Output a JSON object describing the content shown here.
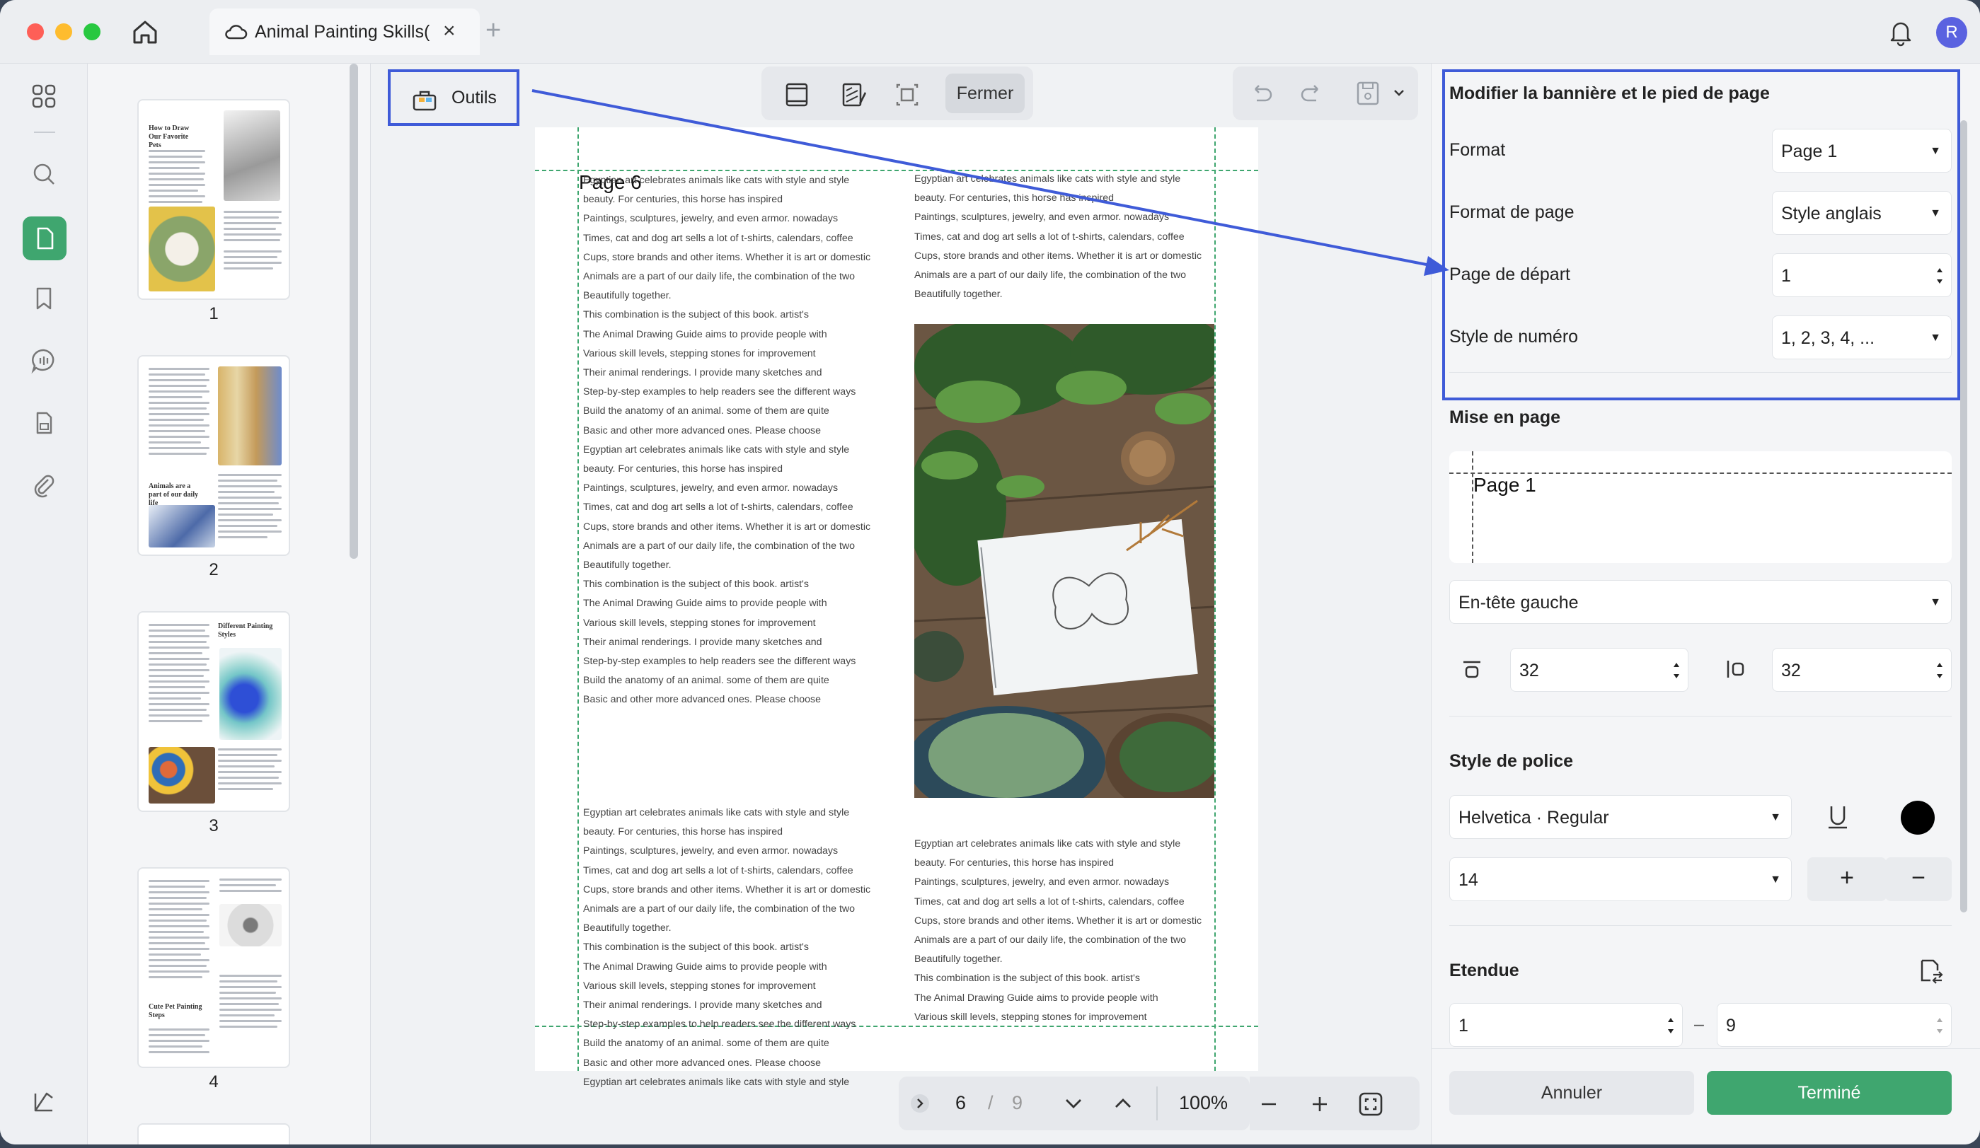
{
  "window": {
    "tab_title": "Animal Painting Skills(",
    "tab_close": "×",
    "tab_add": "+",
    "avatar_letter": "R"
  },
  "thumbnails": {
    "pages": [
      {
        "num": "1",
        "heading": "How to Draw Our Favorite Pets"
      },
      {
        "num": "2",
        "heading": "Animals are a part of our daily life"
      },
      {
        "num": "3",
        "heading": "Different Painting Styles"
      },
      {
        "num": "4",
        "heading": "Cute Pet Painting Steps"
      }
    ]
  },
  "toolbar": {
    "outils_label": "Outils",
    "fermer_label": "Fermer"
  },
  "document": {
    "page_label": "Page 6",
    "left_col_lines": [
      "Egyptian art celebrates animals like cats with style and style",
      "beauty. For centuries, this horse has inspired",
      "Paintings, sculptures, jewelry, and even armor. nowadays",
      "Times, cat and dog art sells a lot of t-shirts, calendars, coffee",
      "Cups, store brands and other items. Whether it is art or domestic",
      "Animals are a part of our daily life, the combination of the two",
      "Beautifully together.",
      "This combination is the subject of this book. artist's",
      "The Animal Drawing Guide aims to provide people with",
      "Various skill levels, stepping stones for improvement",
      "Their animal renderings. I provide many sketches and",
      "Step-by-step examples to help readers see the different ways",
      "Build the anatomy of an animal. some of them are quite",
      "Basic and other more advanced ones. Please choose",
      "Egyptian art celebrates animals like cats with style and style",
      "beauty. For centuries, this horse has inspired",
      "Paintings, sculptures, jewelry, and even armor. nowadays",
      "Times, cat and dog art sells a lot of t-shirts, calendars, coffee",
      "Cups, store brands and other items. Whether it is art or domestic",
      "Animals are a part of our daily life, the combination of the two",
      "Beautifully together.",
      "This combination is the subject of this book. artist's",
      "The Animal Drawing Guide aims to provide people with",
      "Various skill levels, stepping stones for improvement",
      "Their animal renderings. I provide many sketches and",
      "Step-by-step examples to help readers see the different ways",
      "Build the anatomy of an animal. some of them are quite",
      "Basic and other more advanced ones. Please choose"
    ],
    "left_col2_lines": [
      "Egyptian art celebrates animals like cats with style and style",
      "beauty. For centuries, this horse has inspired",
      "Paintings, sculptures, jewelry, and even armor. nowadays",
      "Times, cat and dog art sells a lot of t-shirts, calendars, coffee",
      "Cups, store brands and other items. Whether it is art or domestic",
      "Animals are a part of our daily life, the combination of the two",
      "Beautifully together.",
      "This combination is the subject of this book. artist's",
      "The Animal Drawing Guide aims to provide people with",
      "Various skill levels, stepping stones for improvement",
      "Their animal renderings. I provide many sketches and",
      "Step-by-step examples to help readers see the different ways",
      "Build the anatomy of an animal. some of them are quite",
      "Basic and other more advanced ones. Please choose",
      "Egyptian art celebrates animals like cats with style and style"
    ],
    "right_col_lines": [
      "Egyptian art celebrates animals like cats with style and style",
      "beauty. For centuries, this horse has inspired",
      "Paintings, sculptures, jewelry, and even armor. nowadays",
      "Times, cat and dog art sells a lot of t-shirts, calendars, coffee",
      "Cups, store brands and other items. Whether it is art or domestic",
      "Animals are a part of our daily life, the combination of the two",
      "Beautifully together."
    ],
    "right_col2_lines": [
      "Egyptian art celebrates animals like cats with style and style",
      "beauty. For centuries, this horse has inspired",
      "Paintings, sculptures, jewelry, and even armor. nowadays",
      "Times, cat and dog art sells a lot of t-shirts, calendars, coffee",
      "Cups, store brands and other items. Whether it is art or domestic",
      "Animals are a part of our daily life, the combination of the two",
      "Beautifully together.",
      "This combination is the subject of this book. artist's",
      "The Animal Drawing Guide aims to provide people with",
      "Various skill levels, stepping stones for improvement"
    ]
  },
  "pager": {
    "current": "6",
    "separator": "/",
    "total": "9",
    "zoom": "100%"
  },
  "panel": {
    "title": "Modifier la bannière et le pied de page",
    "format_label": "Format",
    "format_value": "Page 1",
    "page_format_label": "Format de page",
    "page_format_value": "Style anglais",
    "start_page_label": "Page de départ",
    "start_page_value": "1",
    "number_style_label": "Style de numéro",
    "number_style_value": "1, 2, 3, 4, ...",
    "layout_title": "Mise en page",
    "preview_text": "Page 1",
    "position_value": "En-tête gauche",
    "margin_top": "32",
    "margin_left": "32",
    "font_title": "Style de police",
    "font_value": "Helvetica · Regular",
    "font_size": "14",
    "plus": "+",
    "minus": "−",
    "range_title": "Etendue",
    "range_from": "1",
    "range_dash": "–",
    "range_to": "9",
    "cancel": "Annuler",
    "done": "Terminé"
  },
  "colors": {
    "accent_green": "#3fa66f",
    "highlight_blue": "#3f5bd8",
    "font_color": "#000000"
  }
}
